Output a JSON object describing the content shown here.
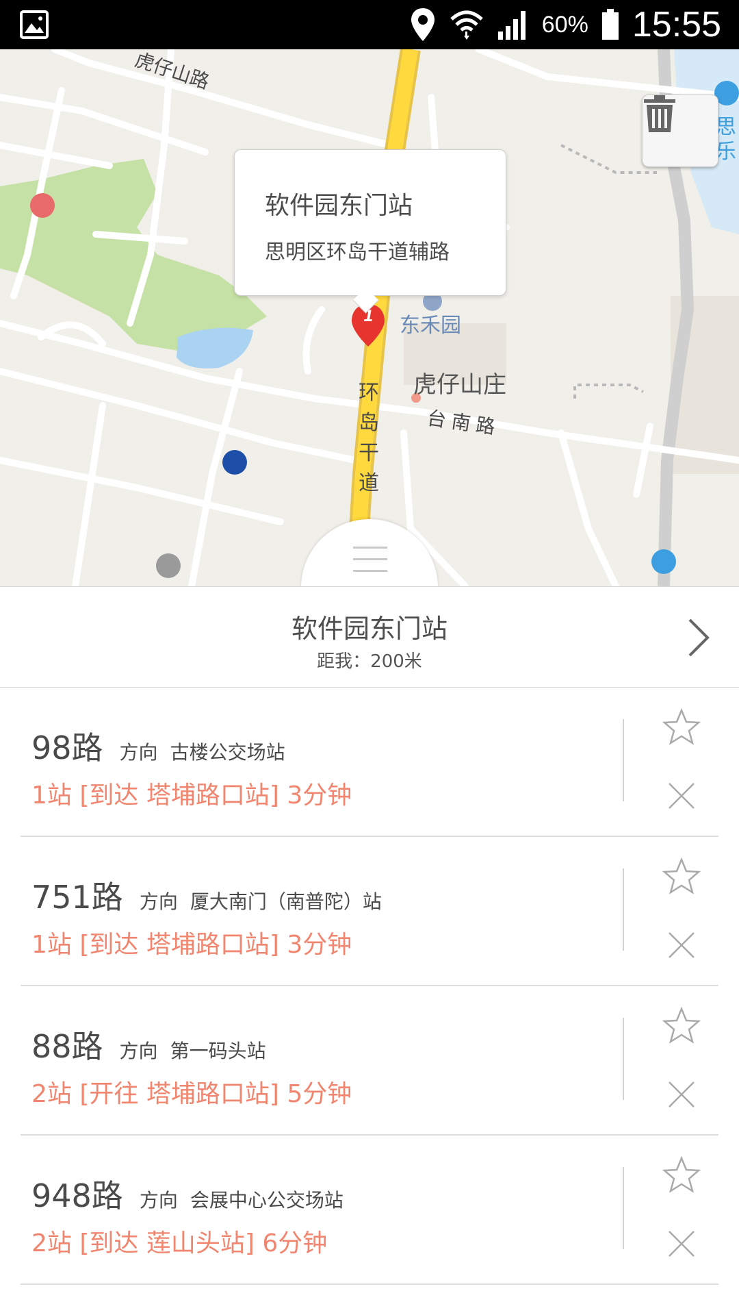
{
  "status_bar": {
    "battery": "60%",
    "time": "15:55"
  },
  "map": {
    "popup": {
      "title": "软件园东门站",
      "address": "思明区环岛干道辅路"
    },
    "marker_number": "1",
    "labels": {
      "huzaishan_road": "虎仔山路",
      "dongheyuan": "东禾园",
      "huzaishanzhuang": "虎仔山庄",
      "tainan_road": "台南路",
      "huandao_road": "环岛干道",
      "si": "思",
      "le": "乐"
    },
    "colors": {
      "road_yellow": "#ffd93d",
      "green_area": "#c6e1a6",
      "water": "#aad3f2",
      "marker_red": "#e8342e"
    }
  },
  "station": {
    "name": "软件园东门站",
    "distance": "距我：200米"
  },
  "bus_lines": [
    {
      "number": "98路",
      "direction_label": "方向",
      "direction": "古楼公交场站",
      "status": "1站 [到达 塔埔路口站]  3分钟"
    },
    {
      "number": "751路",
      "direction_label": "方向",
      "direction": "厦大南门（南普陀）站",
      "status": "1站 [到达 塔埔路口站]  3分钟"
    },
    {
      "number": "88路",
      "direction_label": "方向",
      "direction": "第一码头站",
      "status": "2站 [开往 塔埔路口站]  5分钟"
    },
    {
      "number": "948路",
      "direction_label": "方向",
      "direction": "会展中心公交场站",
      "status": "2站 [到达 莲山头站]  6分钟"
    }
  ],
  "colors": {
    "status_text": "#f0866f"
  }
}
